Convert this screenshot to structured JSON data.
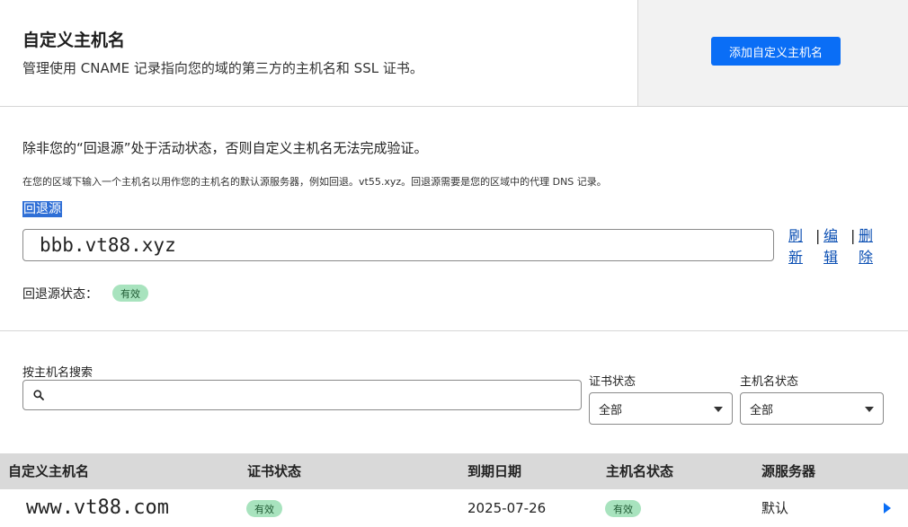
{
  "header": {
    "title": "自定义主机名",
    "subtitle": "管理使用 CNAME 记录指向您的域的第三方的主机名和 SSL 证书。",
    "add_button": "添加自定义主机名"
  },
  "fallback": {
    "warning": "除非您的“回退源”处于活动状态，否则自定义主机名无法完成验证。",
    "help": "在您的区域下输入一个主机名以用作您的主机名的默认源服务器，例如回退。vt55.xyz。回退源需要是您的区域中的代理 DNS 记录。",
    "label": "回退源",
    "value": "bbb.vt88.xyz",
    "refresh": "刷新",
    "edit": "编辑",
    "delete": "删除",
    "separator": "|",
    "status_label": "回退源状态：",
    "status_badge": "有效",
    "status_color": "#a8e3be"
  },
  "filters": {
    "search_label": "按主机名搜索",
    "search_value": "",
    "search_icon": "search-icon",
    "cert_status_label": "证书状态",
    "cert_status_value": "全部",
    "host_status_label": "主机名状态",
    "host_status_value": "全部"
  },
  "table": {
    "columns": [
      "自定义主机名",
      "证书状态",
      "到期日期",
      "主机名状态",
      "源服务器"
    ],
    "rows": [
      {
        "hostname": "www.vt88.com",
        "cert_status": "有效",
        "expiry": "2025-07-26",
        "host_status": "有效",
        "origin": "默认"
      }
    ]
  },
  "colors": {
    "accent": "#0a6ef6",
    "link": "#0b4fb3",
    "selection": "#2f6fd6"
  }
}
